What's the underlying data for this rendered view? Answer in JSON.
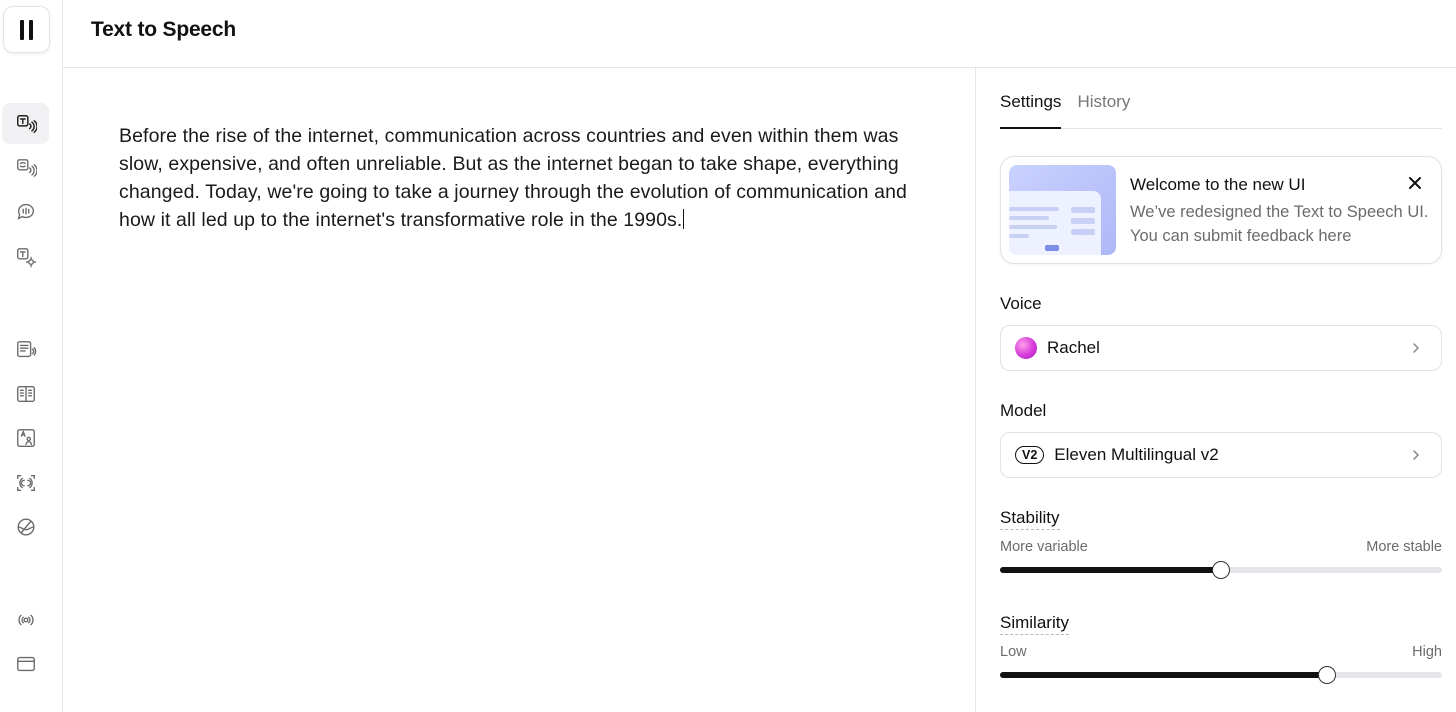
{
  "header": {
    "title": "Text to Speech"
  },
  "sidebar": {
    "logo_icon": "pause-bars-icon",
    "items": [
      {
        "icon": "text-to-speech-icon",
        "active": true
      },
      {
        "icon": "speech-to-speech-icon",
        "active": false
      },
      {
        "icon": "sound-effects-icon",
        "active": false
      },
      {
        "icon": "voice-settings-icon",
        "active": false
      },
      {
        "icon": "projects-icon",
        "active": false
      },
      {
        "icon": "dubbing-icon",
        "active": false
      },
      {
        "icon": "translate-icon",
        "active": false
      },
      {
        "icon": "voice-isolator-icon",
        "active": false
      },
      {
        "icon": "voice-library-icon",
        "active": false
      },
      {
        "icon": "audio-icon",
        "active": false
      },
      {
        "icon": "window-icon",
        "active": false
      }
    ]
  },
  "editor": {
    "text": "Before the rise of the internet, communication across countries and even within them was slow, expensive, and often unreliable. But as the internet began to take shape, everything changed. Today, we're going to take a journey through the evolution of communication and how it all led up to the internet's transformative role in the 1990s."
  },
  "panel": {
    "tabs": [
      {
        "label": "Settings",
        "active": true
      },
      {
        "label": "History",
        "active": false
      }
    ],
    "welcome": {
      "title": "Welcome to the new UI",
      "body": "We’ve redesigned the Text to Speech UI. You can submit feedback here"
    },
    "voice": {
      "label": "Voice",
      "value": "Rachel"
    },
    "model": {
      "label": "Model",
      "badge": "V2",
      "value": "Eleven Multilingual v2"
    },
    "stability": {
      "label": "Stability",
      "min_label": "More variable",
      "max_label": "More stable",
      "value": 0.5
    },
    "similarity": {
      "label": "Similarity",
      "min_label": "Low",
      "max_label": "High",
      "value": 0.74
    }
  },
  "colors": {
    "accent": "#111111",
    "track": "#e5e5ea",
    "muted_text": "#6b6b6b",
    "border": "#e6e6e6"
  }
}
